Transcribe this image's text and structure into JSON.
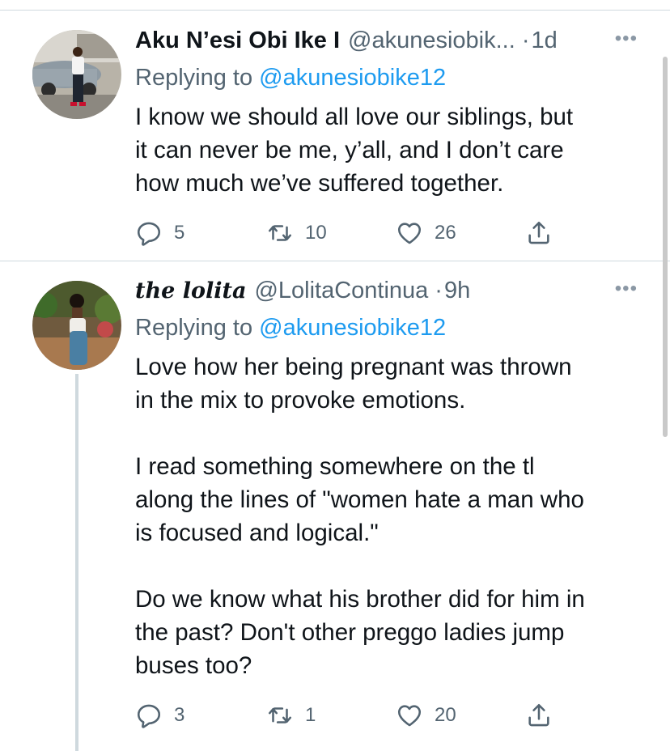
{
  "tweets": [
    {
      "name": "Aku N’esi Obi Ike I",
      "handle": "@akunesiobik...",
      "time": "1d",
      "replying_prefix": "Replying to ",
      "replying_handle": "@akunesiobike12",
      "text": "I know we should all love our siblings, but\nit can never be me, y’all, and I don’t care\nhow much we’ve suffered together.",
      "reply_count": "5",
      "retweet_count": "10",
      "like_count": "26"
    },
    {
      "name_prefix": "the",
      "name_main": "lolita",
      "handle": "@LolitaContinua",
      "time": "9h",
      "replying_prefix": "Replying to ",
      "replying_handle": "@akunesiobike12",
      "text": "Love how her being pregnant was thrown\nin the mix to provoke emotions.\n\nI read something somewhere on the tl\nalong the lines of \"women hate a man who\nis focused and logical.\"\n\nDo we know what his brother did for him in\nthe past? Don't other preggo ladies jump\nbuses too?",
      "reply_count": "3",
      "retweet_count": "1",
      "like_count": "20"
    }
  ],
  "ui": {
    "dot": "·",
    "more": "•••"
  },
  "icons": [
    "reply-icon",
    "retweet-icon",
    "like-icon",
    "share-icon",
    "more-icon"
  ],
  "colors": {
    "link": "#1d9bf0",
    "secondary": "#536471",
    "divider": "#cfd9de"
  }
}
